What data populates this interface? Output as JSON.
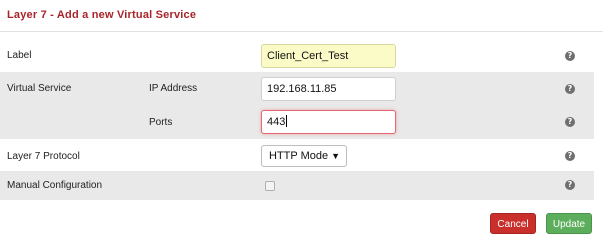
{
  "header": {
    "title": "Layer 7 - Add a new Virtual Service"
  },
  "form": {
    "label": {
      "label": "Label",
      "value": "Client_Cert_Test"
    },
    "virtual_service": {
      "label": "Virtual Service",
      "ip_label": "IP Address",
      "ip_value": "192.168.11.85",
      "ports_label": "Ports",
      "ports_value": "443"
    },
    "protocol": {
      "label": "Layer 7 Protocol",
      "selected": "HTTP Mode",
      "arrow": "▼"
    },
    "manual_config": {
      "label": "Manual Configuration",
      "checked": false
    },
    "help_glyph": "?"
  },
  "actions": {
    "cancel_label": "Cancel",
    "update_label": "Update"
  },
  "colors": {
    "title": "#a8242a",
    "row_shade": "#e9e9e9",
    "label_input_bg": "#fbfbc7",
    "focus_border": "#e26a72",
    "cancel_bg": "#c9302c",
    "update_bg": "#5cae5c",
    "help_icon": "#6f6f6f"
  }
}
